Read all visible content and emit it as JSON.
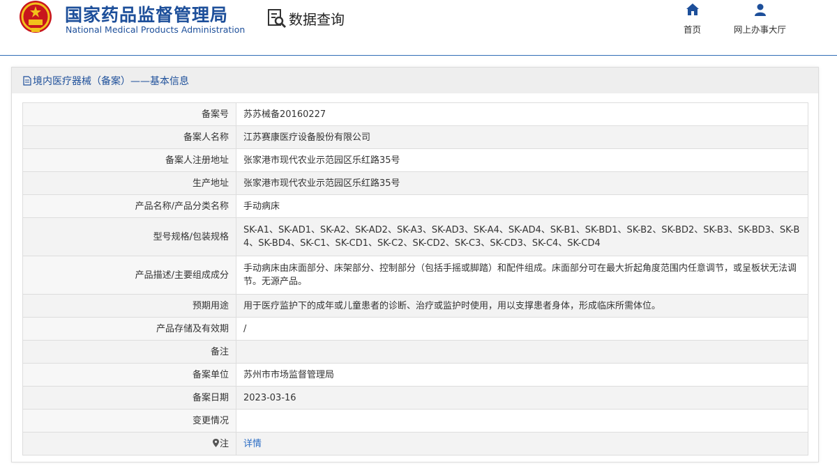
{
  "header": {
    "brand_cn": "国家药品监督管理局",
    "brand_en": "National Medical Products Administration",
    "query_label": "数据查询",
    "nav": [
      {
        "label": "首页",
        "icon": "home-icon"
      },
      {
        "label": "网上办事大厅",
        "icon": "user-icon"
      }
    ],
    "accent_color": "#1d4f9a"
  },
  "panel": {
    "title": "境内医疗器械（备案）——基本信息"
  },
  "rows": [
    {
      "label": "备案号",
      "value": "苏苏械备20160227"
    },
    {
      "label": "备案人名称",
      "value": "江苏赛康医疗设备股份有限公司"
    },
    {
      "label": "备案人注册地址",
      "value": "张家港市现代农业示范园区乐红路35号"
    },
    {
      "label": "生产地址",
      "value": "张家港市现代农业示范园区乐红路35号"
    },
    {
      "label": "产品名称/产品分类名称",
      "value": "手动病床"
    },
    {
      "label": "型号规格/包装规格",
      "value": "SK-A1、SK-AD1、SK-A2、SK-AD2、SK-A3、SK-AD3、SK-A4、SK-AD4、SK-B1、SK-BD1、SK-B2、SK-BD2、SK-B3、SK-BD3、SK-B4、SK-BD4、SK-C1、SK-CD1、SK-C2、SK-CD2、SK-C3、SK-CD3、SK-C4、SK-CD4"
    },
    {
      "label": "产品描述/主要组成成分",
      "value": "手动病床由床面部分、床架部分、控制部分（包括手摇或脚踏）和配件组成。床面部分可在最大折起角度范围内任意调节，或呈板状无法调节。无源产品。"
    },
    {
      "label": "预期用途",
      "value": "用于医疗监护下的成年或儿童患者的诊断、治疗或监护时使用，用以支撑患者身体，形成临床所需体位。"
    },
    {
      "label": "产品存储及有效期",
      "value": "/"
    },
    {
      "label": "备注",
      "value": ""
    },
    {
      "label": "备案单位",
      "value": "苏州市市场监督管理局"
    },
    {
      "label": "备案日期",
      "value": "2023-03-16"
    },
    {
      "label": "变更情况",
      "value": ""
    },
    {
      "label": "注",
      "value": "详情",
      "icon": "location-pin-icon"
    }
  ]
}
